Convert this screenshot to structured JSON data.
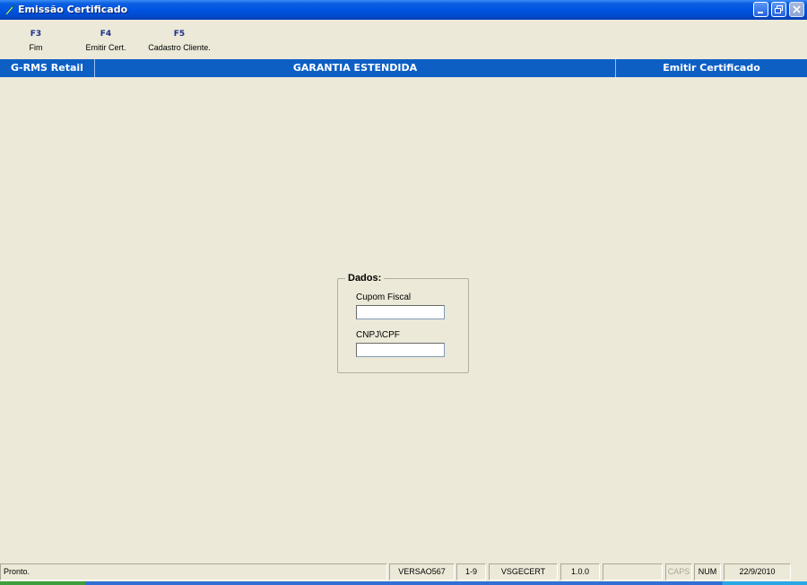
{
  "window": {
    "title": "Emissão Certificado",
    "icon": "app-feather-icon"
  },
  "toolbar": {
    "keys": [
      {
        "key": "F3",
        "label": "Fim"
      },
      {
        "key": "F4",
        "label": "Emitir Cert."
      },
      {
        "key": "F5",
        "label": "Cadastro Cliente."
      }
    ]
  },
  "header": {
    "app_name": "G-RMS Retail",
    "module": "GARANTIA ESTENDIDA",
    "screen": "Emitir Certificado"
  },
  "form": {
    "group_title": "Dados:",
    "cupom_label": "Cupom Fiscal",
    "cupom_value": "",
    "cnpj_label": "CNPJ\\CPF",
    "cnpj_value": ""
  },
  "status": {
    "message": "Pronto.",
    "version": "VERSAO567",
    "range": "1-9",
    "module_code": "VSGECERT",
    "release": "1.0.0",
    "empty": "",
    "caps": "CAPS",
    "num": "NUM",
    "date": "22/9/2010"
  },
  "colors": {
    "titlebar": "#0054e3",
    "header_band": "#0e5fc4",
    "window_bg": "#ece9d8",
    "fkey_text": "#1c2f8c"
  }
}
